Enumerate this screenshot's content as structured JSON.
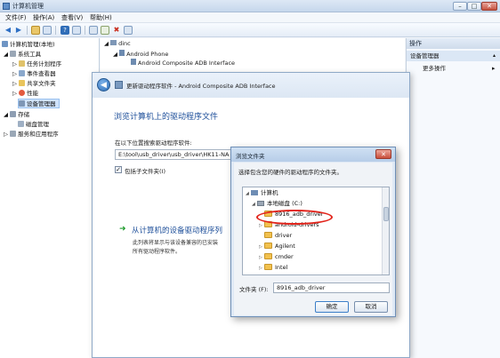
{
  "window": {
    "title": "计算机管理",
    "minimize": "–",
    "maximize": "□",
    "close": "✕"
  },
  "menu": {
    "items": [
      "文件(F)",
      "操作(A)",
      "查看(V)",
      "帮助(H)"
    ]
  },
  "tree": {
    "root": "计算机管理(本地)",
    "system_tools": "系统工具",
    "task_scheduler": "任务计划程序",
    "event_viewer": "事件查看器",
    "shared_folders": "共享文件夹",
    "performance": "性能",
    "device_manager": "设备管理器",
    "storage": "存储",
    "disk_mgmt": "磁盘管理",
    "services_apps": "服务和应用程序"
  },
  "devices": {
    "root": "dinc",
    "phone": "Android Phone",
    "adb": "Android Composite ADB Interface"
  },
  "actions": {
    "header": "操作",
    "device_manager": "设备管理器",
    "more": "更多操作",
    "arrow": "▸",
    "collapse": "▴"
  },
  "update_dialog": {
    "back_glyph": "◀",
    "title": "更新驱动程序软件 - Android Composite ADB Interface",
    "heading": "浏览计算机上的驱动程序文件",
    "search_label": "在以下位置搜索驱动程序软件:",
    "path": "E:\\tool\\usb_driver\\usb_driver\\HK11-NA",
    "include_subfolders": "包括子文件夹(I)",
    "check": "✓",
    "pick_arrow": "➜",
    "pick_title": "从计算机的设备驱动程序列",
    "pick_desc1": "此列表将显示与该设备兼容的已安装",
    "pick_desc2": "所有驱动程序软件。"
  },
  "browse_dialog": {
    "title": "浏览文件夹",
    "close": "✕",
    "prompt": "选择包含您的硬件的驱动程序的文件夹。",
    "computer": "计算机",
    "local_disk": "本地磁盘 (C:)",
    "folders": [
      {
        "name": "8916_adb_driver",
        "expander": ""
      },
      {
        "name": "android-drivers",
        "expander": "▷"
      },
      {
        "name": "driver",
        "expander": ""
      },
      {
        "name": "Agilent",
        "expander": "▷"
      },
      {
        "name": "cmder",
        "expander": "▷"
      },
      {
        "name": "Intel",
        "expander": "▷"
      }
    ],
    "folder_label": "文件夹 (F):",
    "folder_value": "8916_adb_driver",
    "ok": "确定",
    "cancel": "取消"
  },
  "colors": {
    "highlight_ring": "#e2231a",
    "heading_blue": "#1e4f9a",
    "arrow_green": "#1c9a2a"
  }
}
